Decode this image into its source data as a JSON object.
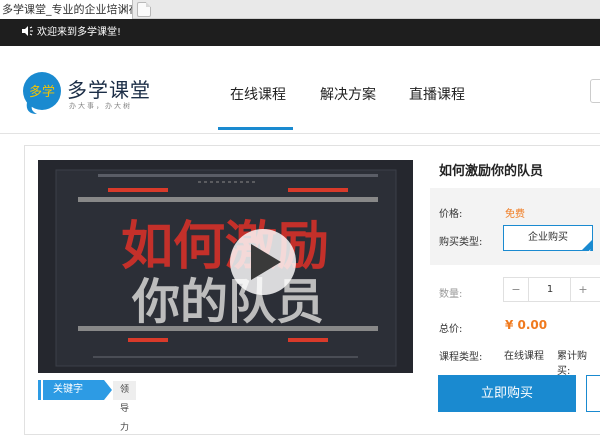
{
  "browser": {
    "tab_title": "多学课堂_专业的企业培训在...",
    "close_glyph": "×"
  },
  "notice": {
    "text": "欢迎来到多学课堂!"
  },
  "logo": {
    "mark_text": "多学",
    "title": "多学课堂",
    "slogan": "办大事，办大树"
  },
  "nav": {
    "items": [
      {
        "label": "在线课程",
        "active": true
      },
      {
        "label": "解决方案",
        "active": false
      },
      {
        "label": "直播课程",
        "active": false
      }
    ]
  },
  "video": {
    "title_line1": "如何激励",
    "title_line2": "你的队员",
    "play_icon": "play-icon"
  },
  "keywords": {
    "label": "关键字",
    "items": [
      "领导力"
    ]
  },
  "course": {
    "title": "如何激励你的队员",
    "price_label": "价格:",
    "price_value": "免费",
    "purchase_type_label": "购买类型:",
    "purchase_type_option": "企业购买",
    "quantity_label": "数量:",
    "quantity_minus": "−",
    "quantity_value": "1",
    "quantity_plus": "+",
    "total_label": "总价:",
    "total_value": "¥ 0.00",
    "course_type_label": "课程类型:",
    "course_type_value": "在线课程",
    "cumulative_label": "累计购买:",
    "buy_now_label": "立即购买"
  },
  "colors": {
    "accent": "#1a8ad0",
    "price": "#f07a1e",
    "notice_bg": "#1e1e1e"
  }
}
